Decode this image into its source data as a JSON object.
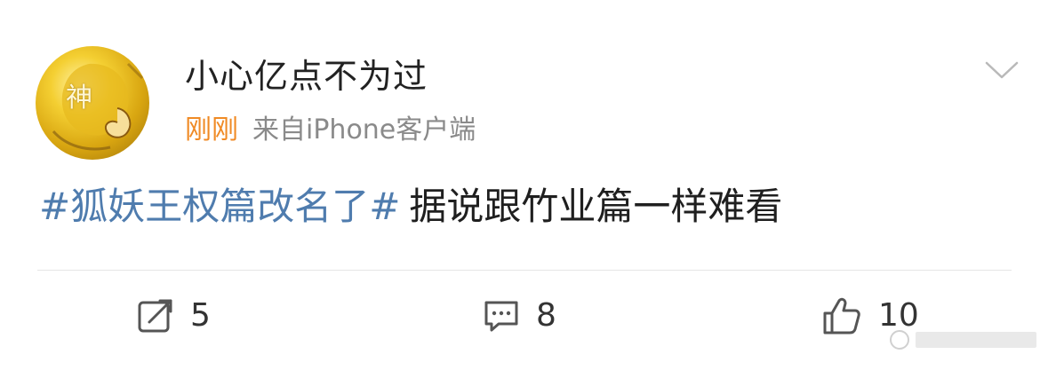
{
  "post": {
    "author": {
      "name": "小心亿点不为过",
      "avatar_text": "神"
    },
    "meta": {
      "time": "刚刚",
      "source": "来自iPhone客户端"
    },
    "content": {
      "topic": "#狐妖王权篇改名了#",
      "text": "据说跟竹业篇一样难看"
    },
    "actions": {
      "repost_count": "5",
      "comment_count": "8",
      "like_count": "10"
    }
  },
  "colors": {
    "topic": "#4f7cae",
    "time": "#f08a24",
    "meta_gray": "#8a8a8a",
    "icon_gray": "#555555"
  },
  "icons": [
    "collapse-chevron-icon",
    "repost-icon",
    "comment-icon",
    "like-icon"
  ]
}
